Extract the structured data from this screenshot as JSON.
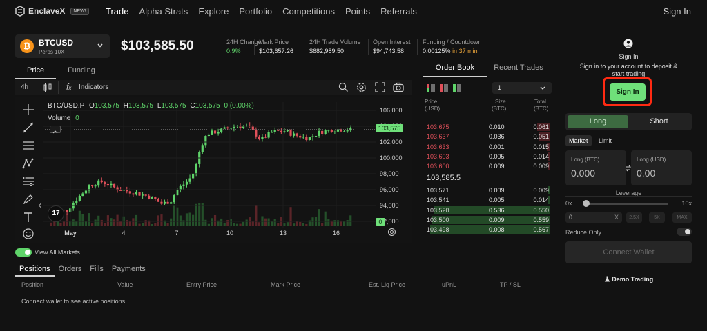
{
  "nav": {
    "brand": "EnclaveX",
    "badge": "NEW!",
    "links": [
      "Trade",
      "Alpha Strats",
      "Explore",
      "Portfolio",
      "Competitions",
      "Points",
      "Referrals"
    ],
    "signin": "Sign In"
  },
  "ticker": {
    "symbol": "BTCUSD",
    "sub": "Perps 10X",
    "coin_glyph": "₿",
    "price": "$103,585.50",
    "stats": [
      {
        "label": "24H Change",
        "value": "0.9%"
      },
      {
        "label": "Mark Price",
        "value": "$103,657.26"
      },
      {
        "label": "24H Trade Volume",
        "value": "$682,989.50"
      },
      {
        "label": "Open Interest",
        "value": "$94,743.58"
      }
    ],
    "funding_label": "Funding / Countdown",
    "funding_rate": "0.00125%",
    "funding_in": "in 37 min"
  },
  "chart": {
    "tabs": [
      "Price",
      "Funding"
    ],
    "interval": "4h",
    "indicators": "Indicators",
    "pair": "BTC/USD.P",
    "o_lbl": "O",
    "o": "103,575",
    "h_lbl": "H",
    "h": "103,575",
    "l_lbl": "L",
    "l": "103,575",
    "c_lbl": "C",
    "c": "103,575",
    "chg": "0 (0.00%)",
    "volume_lbl": "Volume",
    "volume": "0",
    "current_price_tag": "103,575",
    "vol_tag": "0",
    "tv_logo": "17"
  },
  "chart_data": {
    "type": "candlestick",
    "title": "BTC/USD.P",
    "x_ticks": [
      "May",
      "4",
      "7",
      "10",
      "13",
      "16"
    ],
    "y_ticks": [
      "106,000",
      "104,000",
      "102,000",
      "100,000",
      "98,000",
      "96,000",
      "94,000",
      "92,000"
    ],
    "ylim": [
      92000,
      106000
    ],
    "current": 103575
  },
  "orderbook": {
    "tabs": [
      "Order Book",
      "Recent Trades"
    ],
    "group": "1",
    "headers": {
      "price": "Price",
      "price_u": "(USD)",
      "size": "Size",
      "size_u": "(BTC)",
      "total": "Total",
      "total_u": "(BTC)"
    },
    "asks": [
      {
        "price": "103,675",
        "size": "0.010",
        "total": "0.061"
      },
      {
        "price": "103,637",
        "size": "0.036",
        "total": "0.051"
      },
      {
        "price": "103,633",
        "size": "0.001",
        "total": "0.015"
      },
      {
        "price": "103,603",
        "size": "0.005",
        "total": "0.014"
      },
      {
        "price": "103,600",
        "size": "0.009",
        "total": "0.009"
      }
    ],
    "mid": "103,585.5",
    "bids": [
      {
        "price": "103,571",
        "size": "0.009",
        "total": "0.009"
      },
      {
        "price": "103,541",
        "size": "0.005",
        "total": "0.014"
      },
      {
        "price": "103,520",
        "size": "0.536",
        "total": "0.550"
      },
      {
        "price": "103,500",
        "size": "0.009",
        "total": "0.559"
      },
      {
        "price": "103,498",
        "size": "0.008",
        "total": "0.567"
      }
    ]
  },
  "trade": {
    "signin_title": "Sign In",
    "signin_desc_1": "Sign in to your account to deposit &",
    "signin_desc_2": "start trading",
    "signin_btn": "Sign In",
    "long": "Long",
    "short": "Short",
    "market": "Market",
    "limit": "Limit",
    "long_btc_lbl": "Long (BTC)",
    "long_btc_val": "0.000",
    "long_usd_lbl": "Long (USD)",
    "long_usd_val": "0.00",
    "leverage": "Leverage",
    "lev_min": "0x",
    "lev_max": "10x",
    "lev_input": "0",
    "lev_x": "X",
    "presets": [
      "2.5X",
      "5X",
      "MAX"
    ],
    "reduce_only": "Reduce Only",
    "connect": "Connect Wallet",
    "demo": "Demo Trading"
  },
  "positions": {
    "view_all": "View All Markets",
    "tabs": [
      "Positions",
      "Orders",
      "Fills",
      "Payments"
    ],
    "headers": [
      "Position",
      "Value",
      "Entry Price",
      "Mark Price",
      "Est. Liq Price",
      "uPnL",
      "TP / SL"
    ],
    "empty": "Connect wallet to see active positions"
  }
}
